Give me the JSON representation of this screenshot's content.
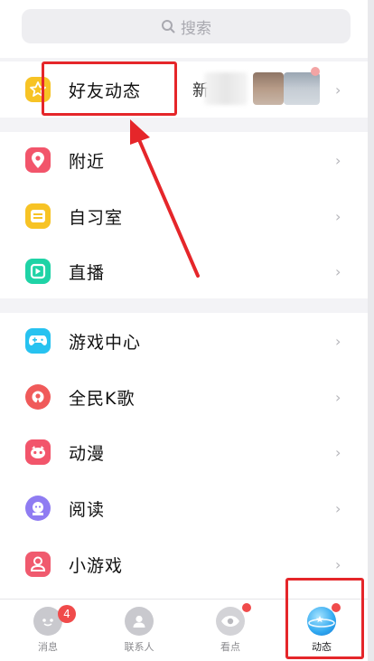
{
  "search": {
    "placeholder": "搜索",
    "icon": "search-icon"
  },
  "friends_feed": {
    "label": "好友动态",
    "preview_text": "新",
    "icon": "star-icon",
    "color": "#f7c325"
  },
  "group1": [
    {
      "label": "附近",
      "icon": "location-pin-icon",
      "color": "#f2556b"
    },
    {
      "label": "自习室",
      "icon": "study-room-icon",
      "color": "#f7c325"
    },
    {
      "label": "直播",
      "icon": "live-icon",
      "color": "#1fd3a6"
    }
  ],
  "group2": [
    {
      "label": "游戏中心",
      "icon": "gamepad-icon",
      "color": "#27c2f0"
    },
    {
      "label": "全民K歌",
      "icon": "karaoke-icon",
      "color": "#f05a5a"
    },
    {
      "label": "动漫",
      "icon": "anime-icon",
      "color": "#f2556b"
    },
    {
      "label": "阅读",
      "icon": "reading-icon",
      "color": "#8f7cf2"
    },
    {
      "label": "小游戏",
      "icon": "mini-game-icon",
      "color": "#f05a6e"
    }
  ],
  "chevron": "›",
  "tabs": [
    {
      "label": "消息",
      "icon": "message-icon",
      "badge": "4"
    },
    {
      "label": "联系人",
      "icon": "contacts-icon"
    },
    {
      "label": "看点",
      "icon": "eye-icon"
    },
    {
      "label": "动态",
      "icon": "planet-icon"
    }
  ],
  "colors": {
    "highlight": "#e5262a",
    "accent_blue": "#2fa8f0",
    "badge": "#f04b4b"
  }
}
